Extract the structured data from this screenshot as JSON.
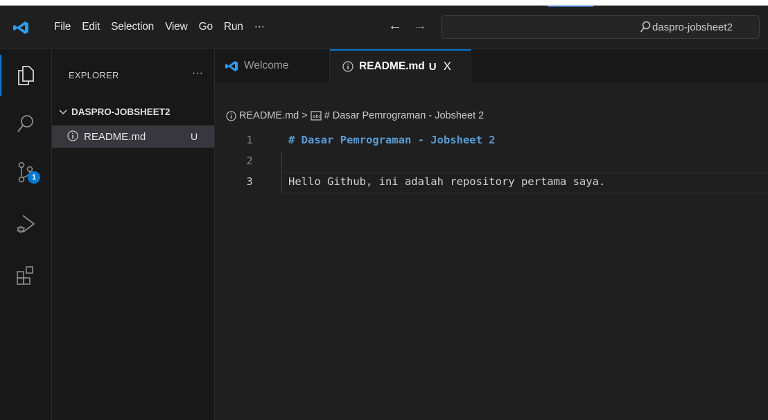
{
  "menu": [
    "File",
    "Edit",
    "Selection",
    "View",
    "Go",
    "Run",
    "···"
  ],
  "nav": {
    "back": "←",
    "forward": "→"
  },
  "search": {
    "text": "daspro-jobsheet2"
  },
  "activity": {
    "source_control_badge": "1"
  },
  "sidebar": {
    "title": "EXPLORER",
    "more": "···",
    "folder": "DASPRO-JOBSHEET2",
    "files": [
      {
        "name": "README.md",
        "status": "U"
      }
    ]
  },
  "tabs": [
    {
      "label": "Welcome"
    },
    {
      "label": "README.md",
      "status": "U",
      "close": "X"
    }
  ],
  "breadcrumb": {
    "file": "README.md",
    "separator": ">",
    "symbol": "# Dasar Pemrograman - Jobsheet 2"
  },
  "editor": {
    "lines": [
      {
        "num": "1",
        "text": "# Dasar Pemrograman - Jobsheet 2"
      },
      {
        "num": "2",
        "text": ""
      },
      {
        "num": "3",
        "text": "Hello Github, ini adalah repository pertama saya."
      }
    ]
  },
  "colors": {
    "accent": "#0078d4",
    "heading": "#569cd6",
    "background": "#1f1f1f"
  }
}
